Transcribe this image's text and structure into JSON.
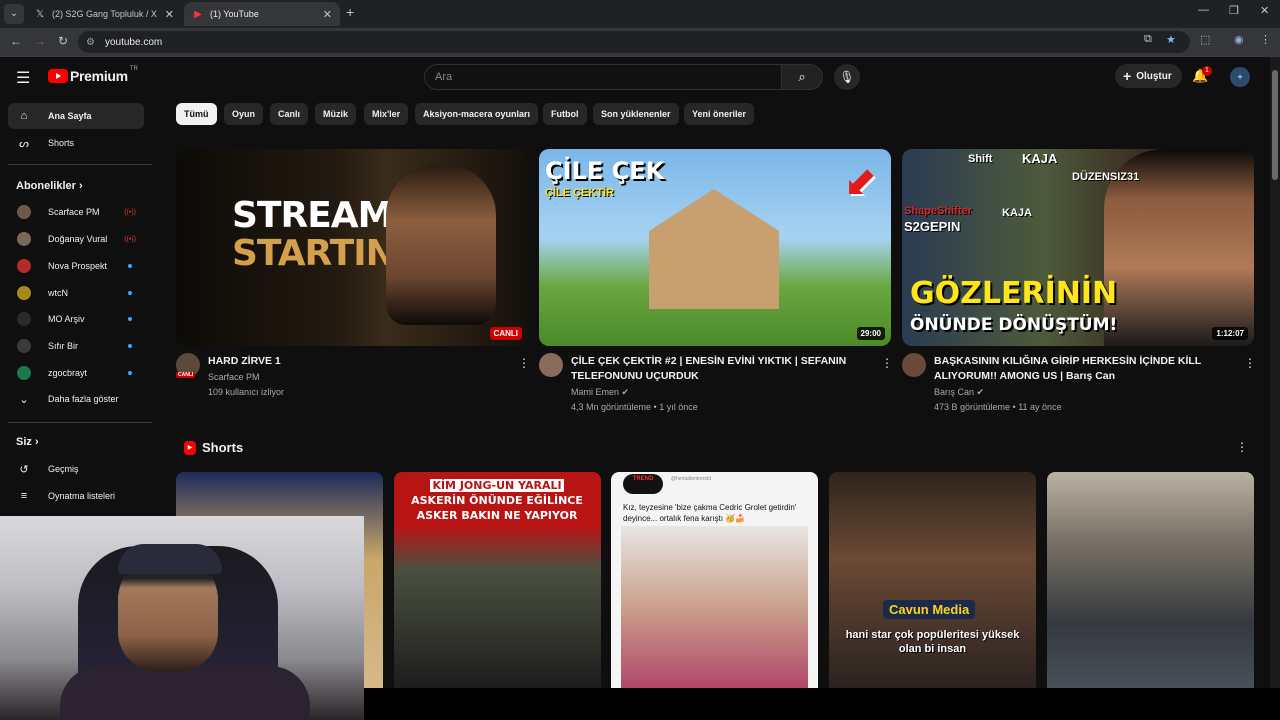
{
  "browser": {
    "tabs": [
      {
        "label": "(2) S2G Gang Topluluk / X"
      },
      {
        "label": "(1) YouTube"
      }
    ],
    "url": "youtube.com"
  },
  "header": {
    "logo_text": "Premium",
    "logo_sup": "TR",
    "search_placeholder": "Ara",
    "create_label": "Oluştur",
    "notification_count": "1"
  },
  "sidebar": {
    "main": [
      {
        "label": "Ana Sayfa"
      },
      {
        "label": "Shorts"
      }
    ],
    "subs_heading": "Abonelikler",
    "subs": [
      {
        "label": "Scarface PM",
        "color": "#6b5a4a"
      },
      {
        "label": "Doğanay Vural",
        "color": "#7a6a5a"
      },
      {
        "label": "Nova Prospekt",
        "color": "#b22a2a"
      },
      {
        "label": "wtcN",
        "color": "#a88a1a"
      },
      {
        "label": "MO Arşiv",
        "color": "#2a2a2a"
      },
      {
        "label": "Sıfır Bir",
        "color": "#3a3a3a"
      },
      {
        "label": "zgocbrayt",
        "color": "#1a7a4a"
      }
    ],
    "show_more": "Daha fazla göster",
    "you_heading": "Siz",
    "you": [
      {
        "label": "Geçmiş"
      },
      {
        "label": "Oynatma listeleri"
      }
    ]
  },
  "chips": [
    "Tümü",
    "Oyun",
    "Canlı",
    "Müzik",
    "Mix'ler",
    "Aksiyon-macera oyunları",
    "Futbol",
    "Son yüklenenler",
    "Yeni öneriler"
  ],
  "videos": [
    {
      "title": "HARD ZİRVE 1",
      "channel": "Scarface PM",
      "meta": "109 kullanıcı izliyor",
      "badge": "CANLI",
      "avatar_tag": "CANLI",
      "thumb_line1": "STREAM",
      "thumb_line2": "STARTING"
    },
    {
      "title": "ÇİLE ÇEK ÇEKTİR #2 | ENESİN EVİNİ YIKTIK | SEFANIN TELEFONUNU UÇURDUK",
      "channel": "Mami Emen",
      "meta": "4,3 Mn görüntüleme • 1 yıl önce",
      "badge": "29:00",
      "thumb_line1": "ÇİLE ÇEK",
      "thumb_line2": "ÇİLE ÇEKTİR"
    },
    {
      "title": "BAŞKASININ KILIĞINA GİRİP HERKESİN İÇİNDE KİLL ALIYORUM!! AMONG US | Barış Can",
      "channel": "Barış Can",
      "meta": "473 B görüntüleme • 11 ay önce",
      "badge": "1:12:07",
      "thumb_line1": "GÖZLERİNİN",
      "thumb_line2": "ÖNÜNDE DÖNÜŞTÜM!",
      "tags": [
        "Shift",
        "KAJA",
        "DÜZENSIZ31",
        "ShapeShifter",
        "S2GEPIN",
        "KAJA"
      ]
    }
  ],
  "shorts": {
    "heading": "Shorts",
    "items": [
      {
        "text": ""
      },
      {
        "text_top": "KİM JONG-UN YARALI",
        "text_mid": "ASKERİN ÖNÜNDE EĞİLİNCE",
        "text_bot": "ASKER BAKIN NE YAPIYOR"
      },
      {
        "logo": "TREND",
        "handle": "@hertaldentrendd",
        "text": "Kız, teyzesine 'bize çakma Cedric Grolet getirdin' deyince... ortalık fena karıştı 🥳🍰"
      },
      {
        "brand": "Cavun Media",
        "text": "hani star çok popüleritesi yüksek olan bi insan"
      },
      {
        "text": ""
      }
    ]
  }
}
